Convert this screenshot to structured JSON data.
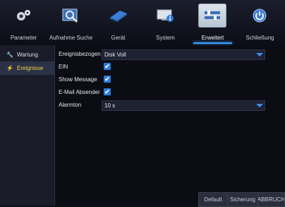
{
  "nav": {
    "items": [
      {
        "label": "Parameter",
        "icon": "gear-icon"
      },
      {
        "label": "Aufnahme Suche",
        "icon": "video-search-icon"
      },
      {
        "label": "Gerät",
        "icon": "harddisk-icon"
      },
      {
        "label": "System",
        "icon": "monitor-info-icon"
      },
      {
        "label": "Erweitert",
        "icon": "advanced-settings-icon"
      },
      {
        "label": "Schließung",
        "icon": "power-icon"
      }
    ],
    "active_index": 4
  },
  "sidebar": {
    "items": [
      {
        "label": "Wartung",
        "icon": "wrench-icon"
      },
      {
        "label": "Ereignisse",
        "icon": "lightning-icon"
      }
    ],
    "active_index": 1
  },
  "form": {
    "event_label": "Ereignisbezogen",
    "event_value": "Disk Voll",
    "ein_label": "EIN",
    "ein_checked": true,
    "show_message_label": "Show Message",
    "show_message_checked": true,
    "email_label": "E-Mail Absender",
    "email_checked": true,
    "alarm_label": "Alarmton",
    "alarm_value": "10 s"
  },
  "buttons": {
    "default_label": "Default",
    "save_label": "Sicherung",
    "cancel_label": "ABBRUCH"
  },
  "colors": {
    "accent": "#3d8df5",
    "active_sidebar_text": "#f3d33b"
  }
}
